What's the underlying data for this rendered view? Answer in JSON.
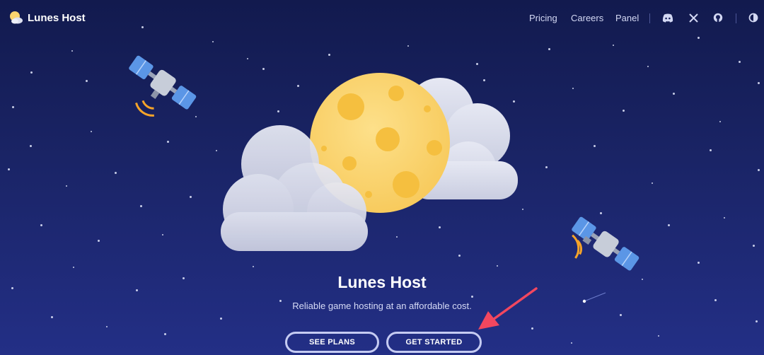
{
  "nav": {
    "brand": "Lunes Host",
    "links": [
      "Pricing",
      "Careers",
      "Panel"
    ],
    "icons": [
      "discord-icon",
      "x-icon",
      "github-icon",
      "theme-toggle-icon"
    ]
  },
  "hero": {
    "title": "Lunes Host",
    "subtitle": "Reliable game hosting at an affordable cost.",
    "see_plans": "SEE PLANS",
    "get_started": "GET STARTED"
  },
  "colors": {
    "background_top": "#121a4e",
    "background_bottom": "#232f86",
    "moon": "#fbd46e",
    "moon_crater": "#f5bf3f",
    "cloud": "#dde0ef",
    "button_border": "#c5cbf2",
    "annotation_arrow": "#f2475f"
  }
}
